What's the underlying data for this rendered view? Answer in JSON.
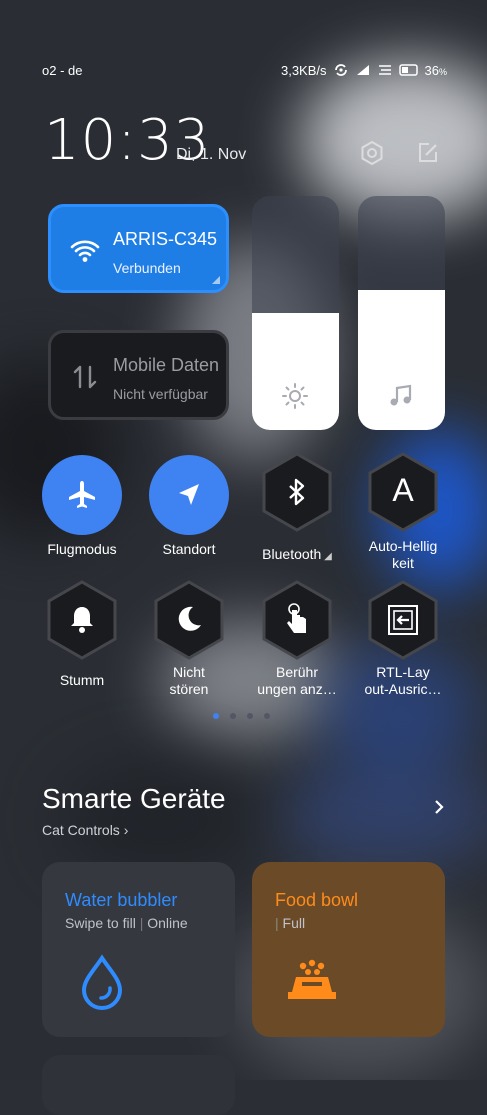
{
  "status": {
    "carrier": "o2 - de",
    "speed": "3,3KB/s",
    "battery": "36"
  },
  "header": {
    "time": "10:33",
    "date": "Di, 1. Nov"
  },
  "tiles": {
    "wifi": {
      "name": "ARRIS-C345",
      "status": "Verbunden"
    },
    "mobile": {
      "name": "Mobile Daten",
      "status": "Nicht verfügbar"
    }
  },
  "sliders": {
    "brightness_level": 0.5,
    "volume_level": 0.6
  },
  "toggles": [
    {
      "label": "Flugmodus"
    },
    {
      "label": "Standort"
    },
    {
      "label": "Bluetooth"
    },
    {
      "label": "Auto-Helligkeit"
    },
    {
      "label": "Stumm"
    },
    {
      "label": "Nicht stören"
    },
    {
      "label": "Berührungen anzeigen"
    },
    {
      "label": "RTL-Layout-Ausrichtung"
    }
  ],
  "toggle_labels_display": {
    "flug": "Flugmodus",
    "standort": "Standort",
    "bluetooth": "Bluetooth",
    "auto1": "Auto-Hellig",
    "auto2": "keit",
    "stumm": "Stumm",
    "nicht1": "Nicht",
    "nicht2": "stören",
    "ber1": "Berühr",
    "ber2": "ungen anz…",
    "rtl1": "RTL-Lay",
    "rtl2": "out-Ausric…"
  },
  "smart": {
    "title": "Smarte Geräte",
    "subtitle": "Cat Controls",
    "cards": [
      {
        "title": "Water bubbler",
        "status": "Swipe to fill",
        "status2": "Online",
        "color": "#2f8cff"
      },
      {
        "title": "Food bowl",
        "status": "",
        "status2": "Full",
        "color": "#ff8c1a"
      }
    ]
  },
  "colors": {
    "accent": "#3f82f2",
    "wifi_tile": "#1f7ee6",
    "food": "#ff8c1a"
  }
}
